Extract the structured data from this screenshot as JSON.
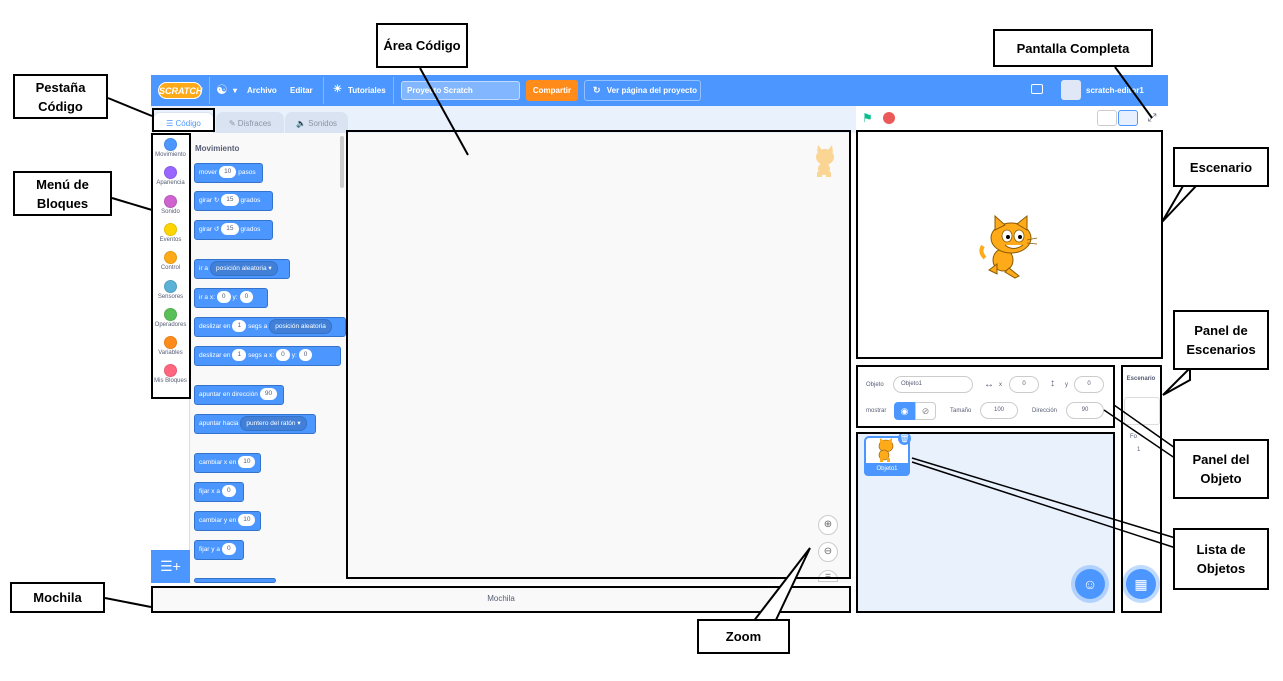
{
  "menubar": {
    "logo": "SCRATCH",
    "file": "Archivo",
    "edit": "Editar",
    "tutorials": "Tutoriales",
    "project_title": "Proyecto Scratch",
    "share": "Compartir",
    "see_project": "Ver página del proyecto",
    "username": "scratch-editor1"
  },
  "tabs": {
    "code": "Código",
    "costumes": "Disfraces",
    "sounds": "Sonidos"
  },
  "categories": [
    {
      "label": "Movimiento",
      "color": "#4c97ff"
    },
    {
      "label": "Apariencia",
      "color": "#9966ff"
    },
    {
      "label": "Sonido",
      "color": "#cf63cf"
    },
    {
      "label": "Eventos",
      "color": "#ffd500"
    },
    {
      "label": "Control",
      "color": "#ffab19"
    },
    {
      "label": "Sensores",
      "color": "#5cb1d6"
    },
    {
      "label": "Operadores",
      "color": "#59c059"
    },
    {
      "label": "Variables",
      "color": "#ff8c1a"
    },
    {
      "label": "Mis Bloques",
      "color": "#ff6680"
    }
  ],
  "flyout": {
    "title": "Movimiento",
    "move": {
      "a": "mover",
      "v": "10",
      "b": "pasos"
    },
    "turn_right": {
      "a": "girar",
      "v": "15",
      "b": "grados"
    },
    "turn_left": {
      "a": "girar",
      "v": "15",
      "b": "grados"
    },
    "goto": {
      "a": "ir a",
      "d": "posición aleatoria"
    },
    "goto_xy": {
      "a": "ir a x:",
      "x": "0",
      "b": "y:",
      "y": "0"
    },
    "glide": {
      "a": "deslizar en",
      "v": "1",
      "b": "segs a",
      "d": "posición aleatoria"
    },
    "glide_xy": {
      "a": "deslizar en",
      "v": "1",
      "b": "segs a x:",
      "x": "0",
      "c": "y:",
      "y": "0"
    },
    "point_dir": {
      "a": "apuntar en dirección",
      "v": "90"
    },
    "point_towards": {
      "a": "apuntar hacia",
      "d": "puntero del ratón"
    },
    "change_x": {
      "a": "cambiar x en",
      "v": "10"
    },
    "set_x": {
      "a": "fijar x a",
      "v": "0"
    },
    "change_y": {
      "a": "cambiar y en",
      "v": "10"
    },
    "set_y": {
      "a": "fijar y a",
      "v": "0"
    }
  },
  "backpack": "Mochila",
  "sprite_info": {
    "sprite_label": "Objeto",
    "sprite_name": "Objeto1",
    "x_label": "x",
    "x": "0",
    "y_label": "y",
    "y": "0",
    "show_label": "mostrar",
    "size_label": "Tamaño",
    "size": "100",
    "direction_label": "Dirección",
    "direction": "90"
  },
  "sprite_list": {
    "sprite1": "Objeto1"
  },
  "stage_panel": {
    "title": "Escenario",
    "backdrops_label": "Fo",
    "backdrops_count": "1"
  },
  "annotations": {
    "code_tab": "Pestaña Código",
    "blocks_menu": "Menú de Bloques",
    "code_area": "Área Código",
    "fullscreen": "Pantalla Completa",
    "stage": "Escenario",
    "stage_panel": "Panel de Escenarios",
    "sprite_panel": "Panel del Objeto",
    "sprite_list": "Lista de Objetos",
    "backpack": "Mochila",
    "zoom": "Zoom"
  }
}
